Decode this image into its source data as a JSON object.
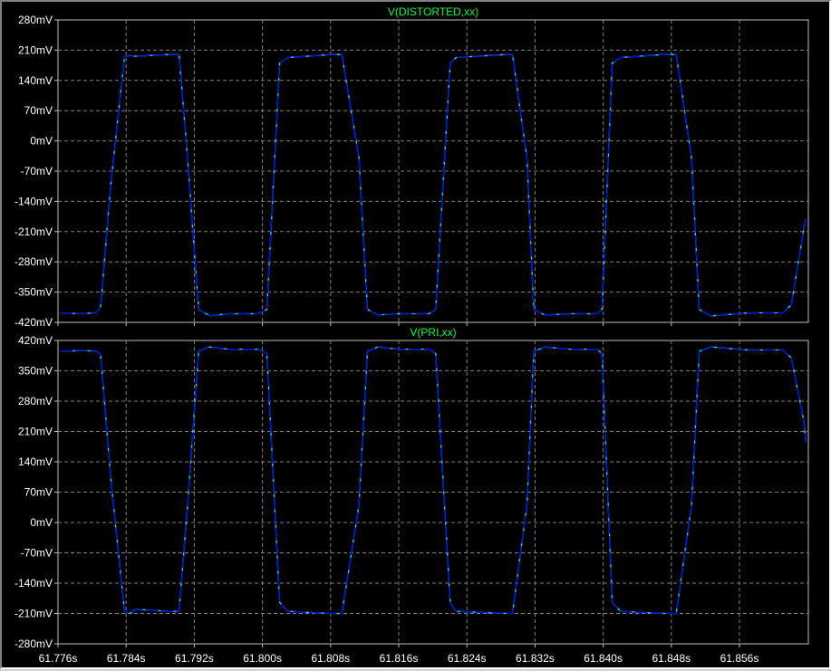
{
  "colors": {
    "background": "#000000",
    "grid": "#808080",
    "frame": "#c0c0c0",
    "text": "#ffffff",
    "trace_title": "#00ff33",
    "trace_primary": "#00ffcc",
    "trace_secondary": "#0000ff"
  },
  "chart_data": [
    {
      "type": "line",
      "title": "V(DISTORTED,xx)",
      "xlabel": "",
      "ylabel": "",
      "x_unit": "s",
      "y_unit": "mV",
      "xlim": [
        61.776,
        61.864
      ],
      "ylim": [
        -420,
        280
      ],
      "x_ticks": [
        "61.776s",
        "61.784s",
        "61.792s",
        "61.800s",
        "61.808s",
        "61.816s",
        "61.824s",
        "61.832s",
        "61.840s",
        "61.848s",
        "61.856s"
      ],
      "y_ticks": [
        "280mV",
        "210mV",
        "140mV",
        "70mV",
        "0mV",
        "-70mV",
        "-140mV",
        "-210mV",
        "-280mV",
        "-350mV",
        "-420mV"
      ],
      "grid": true,
      "series": [
        {
          "x": [
            61.7762,
            61.779,
            61.7805,
            61.781,
            61.7822,
            61.7838,
            61.7845,
            61.785,
            61.789,
            61.7902,
            61.7912,
            61.7925,
            61.7938,
            61.796,
            61.7995,
            61.8005,
            61.802,
            61.803,
            61.808,
            61.8093,
            61.8113,
            61.8123,
            61.8135,
            61.816,
            61.8195,
            61.8203,
            61.822,
            61.8227,
            61.8285,
            61.8293,
            61.831,
            61.8318,
            61.8331,
            61.836,
            61.8392,
            61.8398,
            61.841,
            61.842,
            61.847,
            61.8485,
            61.8503,
            61.8512,
            61.8526,
            61.857,
            61.861,
            61.862,
            61.8635,
            61.8637
          ],
          "y": [
            -398,
            -400,
            -397,
            -385,
            -100,
            195,
            198,
            196,
            200,
            200,
            -40,
            -390,
            -405,
            -400,
            -400,
            -390,
            180,
            193,
            200,
            200,
            -40,
            -390,
            -403,
            -400,
            -400,
            -390,
            180,
            193,
            200,
            200,
            -40,
            -390,
            -403,
            -400,
            -400,
            -390,
            180,
            193,
            200,
            200,
            -40,
            -390,
            -405,
            -398,
            -398,
            -380,
            -200,
            -180
          ]
        }
      ]
    },
    {
      "type": "line",
      "title": "V(PRI,xx)",
      "xlabel": "",
      "ylabel": "",
      "x_unit": "s",
      "y_unit": "mV",
      "xlim": [
        61.776,
        61.864
      ],
      "ylim": [
        -280,
        420
      ],
      "x_ticks": [
        "61.776s",
        "61.784s",
        "61.792s",
        "61.800s",
        "61.808s",
        "61.816s",
        "61.824s",
        "61.832s",
        "61.840s",
        "61.848s",
        "61.856s"
      ],
      "y_ticks": [
        "420mV",
        "350mV",
        "280mV",
        "210mV",
        "140mV",
        "70mV",
        "0mV",
        "-70mV",
        "-140mV",
        "-210mV",
        "-280mV"
      ],
      "grid": true,
      "series": [
        {
          "x": [
            61.7762,
            61.779,
            61.7805,
            61.781,
            61.7822,
            61.7838,
            61.7845,
            61.785,
            61.789,
            61.7902,
            61.7912,
            61.7925,
            61.7938,
            61.796,
            61.7995,
            61.8005,
            61.802,
            61.803,
            61.808,
            61.8093,
            61.8113,
            61.8123,
            61.8135,
            61.816,
            61.8195,
            61.8203,
            61.822,
            61.8227,
            61.8285,
            61.8293,
            61.831,
            61.8318,
            61.8331,
            61.836,
            61.8392,
            61.8398,
            61.841,
            61.842,
            61.847,
            61.8485,
            61.8503,
            61.8512,
            61.8526,
            61.857,
            61.861,
            61.862,
            61.8635,
            61.8637
          ],
          "y": [
            395,
            397,
            395,
            388,
            100,
            -205,
            -210,
            -200,
            -205,
            -205,
            40,
            395,
            405,
            400,
            400,
            390,
            -185,
            -205,
            -210,
            -210,
            40,
            395,
            405,
            400,
            400,
            390,
            -185,
            -205,
            -210,
            -210,
            40,
            395,
            405,
            400,
            400,
            390,
            -185,
            -205,
            -210,
            -210,
            40,
            395,
            405,
            398,
            398,
            380,
            230,
            185
          ]
        }
      ]
    }
  ]
}
